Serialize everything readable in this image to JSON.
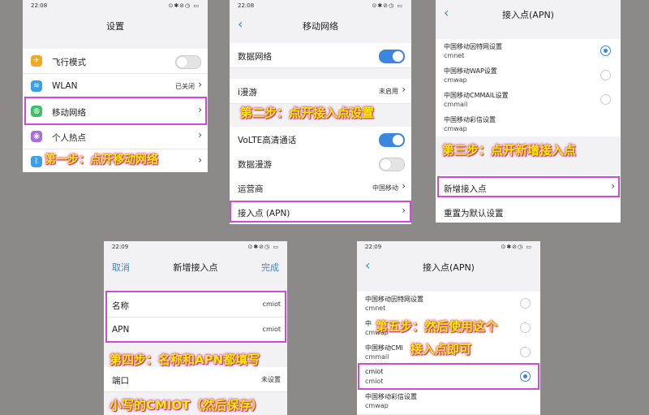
{
  "colors": {
    "accent": "#3a86e0",
    "highlight": "#d04ad8",
    "step_text": "#ffec00",
    "background": "#8c8a88"
  },
  "panel1": {
    "time": "22:08",
    "status_icons": "⊙✱⊘◷ ▭",
    "title": "设置",
    "rows": [
      {
        "label": "飞行模式",
        "icon": "airplane-icon",
        "icon_color": "#f5a623"
      },
      {
        "label": "WLAN",
        "value": "已关闭",
        "icon": "wifi-icon",
        "icon_color": "#3aa0e8"
      },
      {
        "label": "移动网络",
        "icon": "globe-icon",
        "icon_color": "#3cbf6b"
      },
      {
        "label": "个人热点",
        "icon": "hotspot-icon",
        "icon_color": "#b06ae0"
      },
      {
        "label": "蓝牙",
        "icon": "bluetooth-icon",
        "icon_color": "#3aa0e8"
      }
    ],
    "step": "第一步：点开移动网络"
  },
  "panel2": {
    "time": "22:08",
    "status_icons": "⊙✱⊘◷ ▭",
    "title": "移动网络",
    "rows": [
      {
        "label": "数据网络"
      },
      {
        "label": "i漫游",
        "value": "未启用"
      },
      {
        "label": "VoLTE高清通话"
      },
      {
        "label": "数据漫游"
      },
      {
        "label": "运营商",
        "value": "中国移动"
      },
      {
        "label": "接入点 (APN)"
      }
    ],
    "step": "第二步：点开接入点设置"
  },
  "panel3": {
    "title": "接入点(APN)",
    "apns": [
      {
        "name": "中国移动因特网设置",
        "type": "cmnet"
      },
      {
        "name": "中国移动WAP设置",
        "type": "cmwap"
      },
      {
        "name": "中国移动CMMAIL设置",
        "type": "cmmail"
      },
      {
        "name": "中国移动彩信设置",
        "type": "cmwap"
      }
    ],
    "add": "新增接入点",
    "reset": "重置为默认设置",
    "step": "第三步：点开新增接入点"
  },
  "panel4": {
    "time": "22:09",
    "status_icons": "⊙✱⊘◷ ▭",
    "cancel": "取消",
    "title": "新增接入点",
    "done": "完成",
    "rows": [
      {
        "label": "名称",
        "value": "cmiot"
      },
      {
        "label": "APN",
        "value": "cmiot"
      },
      {
        "label": "端口",
        "value": "未设置"
      }
    ],
    "step_a": "第四步：名称和APN都填写",
    "step_b": "小写的CMIOT（然后保存）"
  },
  "panel5": {
    "time": "22:09",
    "status_icons": "⊙✱⊘◷ ▭",
    "title": "接入点(APN)",
    "apns": [
      {
        "name": "中国移动因特网设置",
        "type": "cmnet"
      },
      {
        "name": "中",
        "type": "cmwap"
      },
      {
        "name": "中国移动CMI",
        "type": "cmmail"
      },
      {
        "name": "cmiot",
        "type": "cmiot"
      },
      {
        "name": "中国移动彩信设置",
        "type": "cmwap"
      }
    ],
    "step_a": "第五步：然后使用这个",
    "step_b": "接入点即可"
  }
}
